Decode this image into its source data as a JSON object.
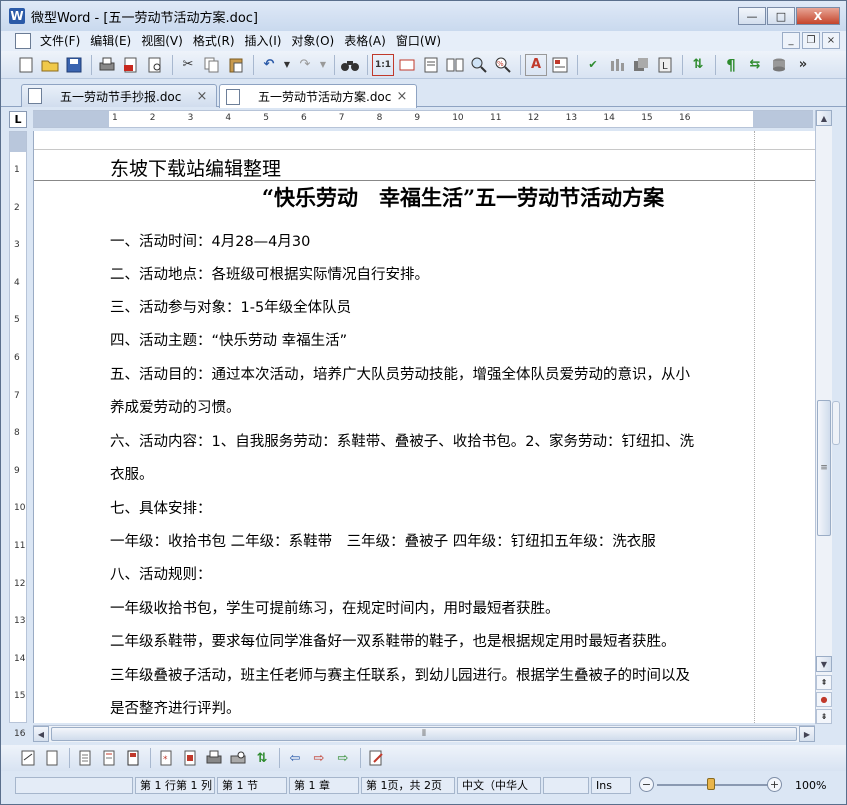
{
  "window": {
    "title": "微型Word - [五一劳动节活动方案.doc]",
    "app_icon_letter": "W",
    "minimize": "—",
    "maximize": "□",
    "close": "X"
  },
  "menu": {
    "items": [
      "文件(F)",
      "编辑(E)",
      "视图(V)",
      "格式(R)",
      "插入(I)",
      "对象(O)",
      "表格(A)",
      "窗口(W)"
    ],
    "doc_minimize": "_",
    "doc_restore": "❐",
    "doc_close": "×"
  },
  "toolbar": {
    "more": "»"
  },
  "tabs": [
    {
      "label": "五一劳动节手抄报.doc",
      "close": "×"
    },
    {
      "label": "五一劳动节活动方案.doc",
      "close": "×"
    }
  ],
  "ruler": {
    "corner": "L",
    "h_numbers": [
      "1",
      "2",
      "3",
      "4",
      "5",
      "6",
      "7",
      "8",
      "9",
      "10",
      "11",
      "12",
      "13",
      "14",
      "15",
      "16"
    ],
    "v_numbers": [
      "1",
      "2",
      "3",
      "4",
      "5",
      "6",
      "7",
      "8",
      "9",
      "10",
      "11",
      "12",
      "13",
      "14",
      "15",
      "16"
    ]
  },
  "document": {
    "header": "东坡下载站编辑整理",
    "title": "“快乐劳动　幸福生活”五一劳动节活动方案",
    "paragraphs": [
      "一、活动时间：4月28—4月30",
      "二、活动地点：各班级可根据实际情况自行安排。",
      "三、活动参与对象：1-5年级全体队员",
      "四、活动主题：“快乐劳动 幸福生活”",
      "五、活动目的：通过本次活动，培养广大队员劳动技能，增强全体队员爱劳动的意识，从小",
      "养成爱劳动的习惯。",
      "六、活动内容：1、自我服务劳动：系鞋带、叠被子、收拾书包。2、家务劳动：钉纽扣、洗",
      "衣服。",
      "七、具体安排：",
      "一年级：收拾书包 二年级：系鞋带　三年级：叠被子 四年级：钉纽扣五年级：洗衣服",
      "八、活动规则：",
      "一年级收拾书包，学生可提前练习，在规定时间内，用时最短者获胜。",
      "二年级系鞋带，要求每位同学准备好一双系鞋带的鞋子，也是根据规定用时最短者获胜。",
      "三年级叠被子活动，班主任老师与赛主任联系，到幼儿园进行。根据学生叠被子的时间以及",
      "是否整齐进行评判。"
    ]
  },
  "statusbar": {
    "cells": [
      "",
      "第 1 行第 1 列",
      "第 1 节",
      "第 1 章",
      "第 1页，共 2页",
      "中文（中华人",
      "",
      "Ins"
    ],
    "zoom_minus": "−",
    "zoom_plus": "+",
    "zoom": "100%"
  },
  "colors": {
    "accent": "#2b5aa8",
    "window_bg": "#dbe6f4"
  }
}
